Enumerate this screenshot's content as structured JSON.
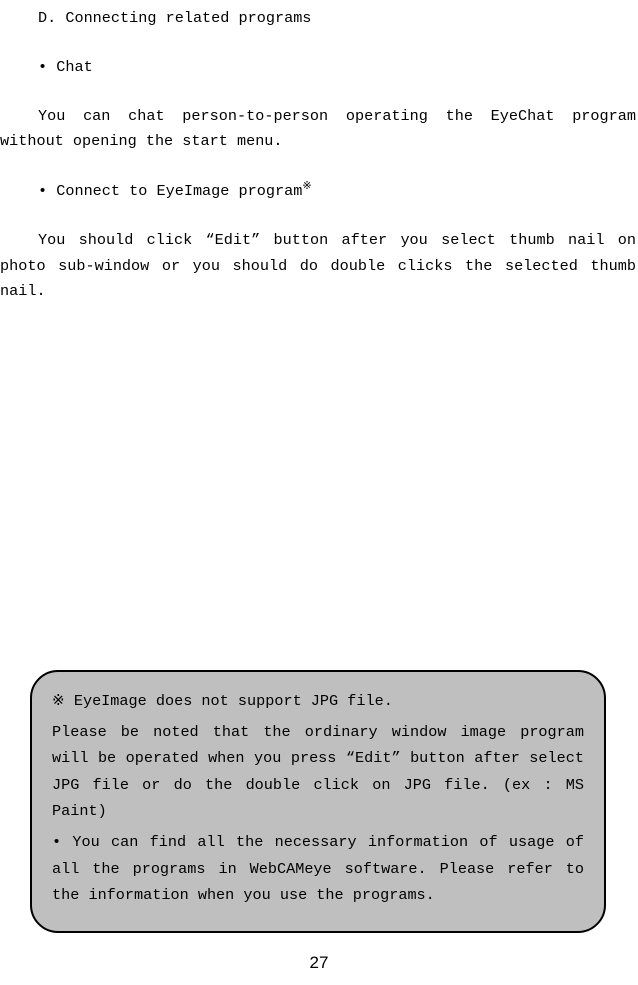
{
  "heading": "D. Connecting related programs",
  "bullet1": "• Chat",
  "para1": "You can chat person-to-person operating the EyeChat program without opening the start menu.",
  "bullet2_pre": "• Connect to EyeImage program",
  "bullet2_sup": "※",
  "para2": "You should click “Edit” button after you select thumb nail on photo sub-window or you should do double clicks the selected thumb nail.",
  "note": {
    "l1": "※ EyeImage does not support JPG file.",
    "l2": "Please be noted that the ordinary window image program will be operated when you press “Edit” button after select JPG file or do the double click on JPG file. (ex : MS Paint)",
    "l3": "• You can find all the necessary information of usage of all the programs in WebCAMeye software. Please refer to the information when you use the programs."
  },
  "page_number": "27"
}
